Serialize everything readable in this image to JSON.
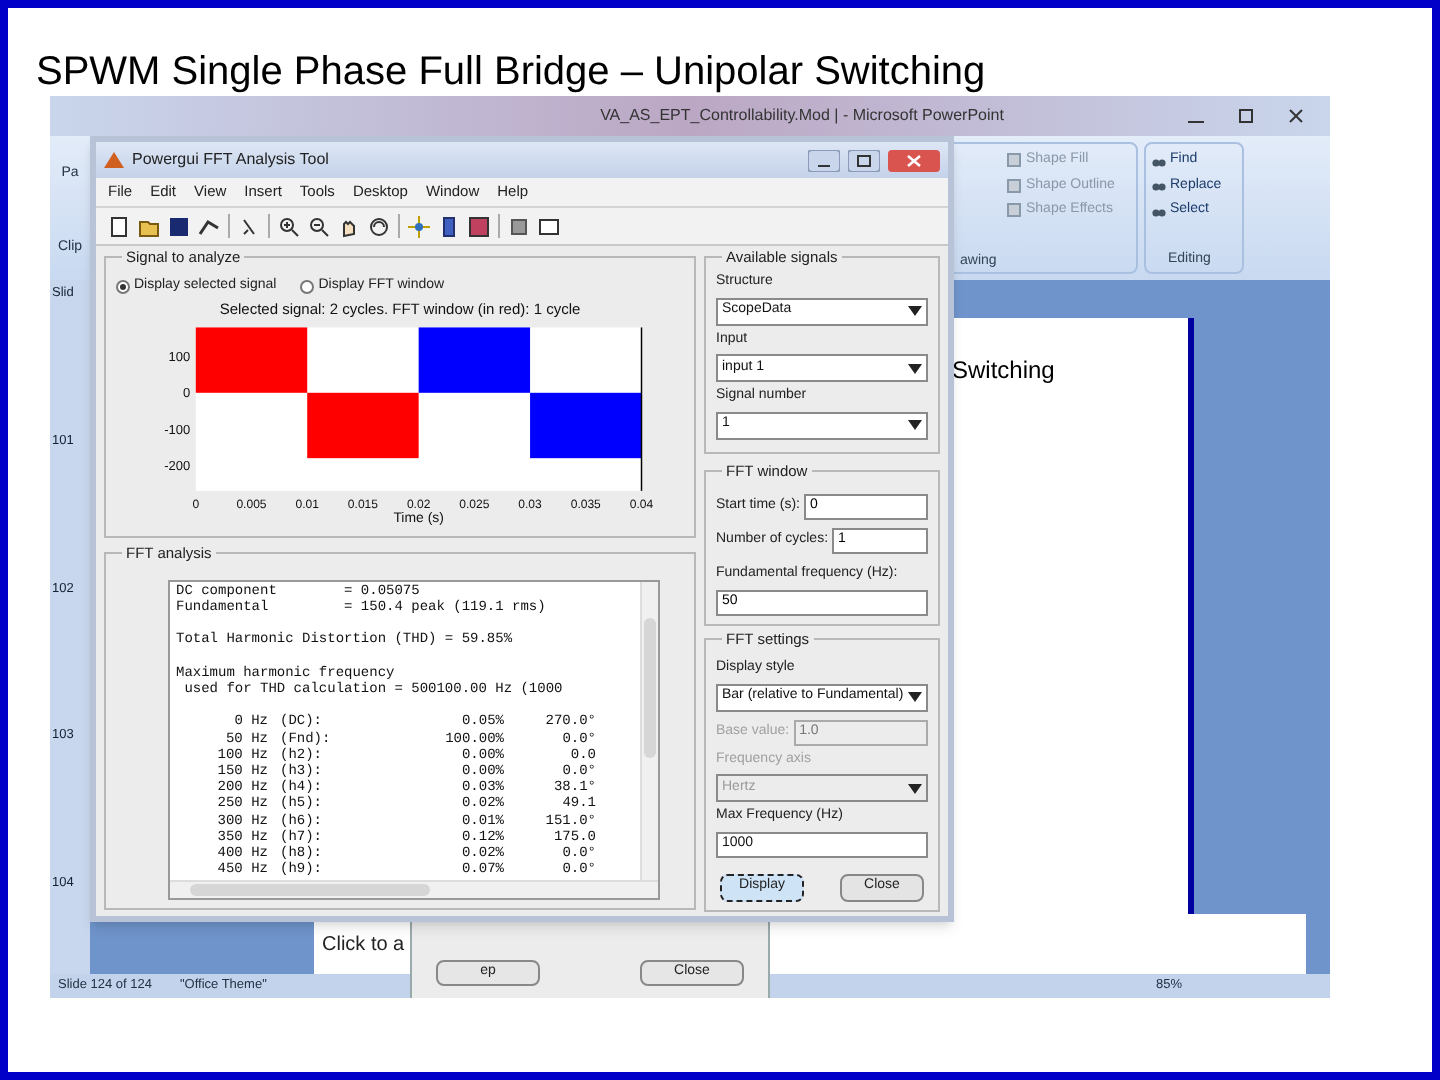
{
  "slide_title": "SPWM Single Phase Full Bridge – Unipolar Switching",
  "powerpoint": {
    "title": "VA_AS_EPT_Controllability.Mod | - Microsoft PowerPoint",
    "ribbon_left": [
      {
        "label": "Pa"
      },
      {
        "label": "Clip"
      }
    ],
    "drawing_items": [
      {
        "label": "Shape Fill"
      },
      {
        "label": "Shape Outline"
      },
      {
        "label": "Shape Effects"
      }
    ],
    "drawing_group": "awing",
    "editing_items": [
      {
        "label": "Find"
      },
      {
        "label": "Replace"
      },
      {
        "label": "Select"
      }
    ],
    "editing_group": "Editing",
    "slide_tab": "Slid",
    "thumb_numbers": [
      "101",
      "102",
      "103",
      "104"
    ],
    "slide_preview_text": "Switching",
    "notes_placeholder": "Click to a",
    "status": [
      {
        "label": "Slide 124 of 124"
      },
      {
        "label": "\"Office Theme\""
      }
    ],
    "zoom": "85%"
  },
  "back_dialog": {
    "buttons": [
      "ep",
      "Close"
    ]
  },
  "fft_window": {
    "title": "Powergui FFT Analysis Tool",
    "menu": [
      "File",
      "Edit",
      "View",
      "Insert",
      "Tools",
      "Desktop",
      "Window",
      "Help"
    ],
    "signal_group": {
      "title": "Signal to analyze",
      "radios": [
        {
          "label": "Display selected signal",
          "selected": true
        },
        {
          "label": "Display FFT window",
          "selected": false
        }
      ],
      "chart_data": {
        "type": "bar",
        "title": "Selected signal: 2 cycles. FFT window (in red): 1 cycle",
        "xlabel": "Time (s)",
        "x": [
          0.005,
          0.015,
          0.025,
          0.035
        ],
        "xlim": [
          0,
          0.04
        ],
        "ylim": [
          -270,
          180
        ],
        "series": [
          {
            "color": "#ff0000",
            "values": [
              180,
              -180,
              null,
              null
            ]
          },
          {
            "color": "#0000ff",
            "values": [
              null,
              null,
              180,
              -180
            ]
          }
        ],
        "xticks": [
          {
            "value": 0,
            "label": "0"
          },
          {
            "value": 0.005,
            "label": "0.005"
          },
          {
            "value": 0.01,
            "label": "0.01"
          },
          {
            "value": 0.015,
            "label": "0.015"
          },
          {
            "value": 0.02,
            "label": "0.02"
          },
          {
            "value": 0.025,
            "label": "0.025"
          },
          {
            "value": 0.03,
            "label": "0.03"
          },
          {
            "value": 0.035,
            "label": "0.035"
          },
          {
            "value": 0.04,
            "label": "0.04"
          }
        ],
        "yticks": [
          100,
          0,
          -100,
          -200
        ]
      }
    },
    "analysis_group": {
      "title": "FFT analysis",
      "summary": [
        [
          "DC component        = 0.05075",
          "Fundamental         = 150.4 peak (119.1 rms)"
        ],
        [
          "Total Harmonic Distortion (THD) = 59.85%"
        ],
        [
          "Maximum harmonic frequency",
          " used for THD calculation = 500100.00 Hz (1000"
        ]
      ],
      "harmonics": [
        {
          "freq": "0 Hz",
          "order": "(DC):",
          "mag": "0.05%",
          "phase": "270.0°"
        },
        {
          "freq": "50 Hz",
          "order": "(Fnd):",
          "mag": "100.00%",
          "phase": "0.0°"
        },
        {
          "freq": "100 Hz",
          "order": "(h2):",
          "mag": "0.00%",
          "phase": "0.0"
        },
        {
          "freq": "150 Hz",
          "order": "(h3):",
          "mag": "0.00%",
          "phase": "0.0°"
        },
        {
          "freq": "200 Hz",
          "order": "(h4):",
          "mag": "0.03%",
          "phase": "38.1°"
        },
        {
          "freq": "250 Hz",
          "order": "(h5):",
          "mag": "0.02%",
          "phase": "49.1"
        },
        {
          "freq": "300 Hz",
          "order": "(h6):",
          "mag": "0.01%",
          "phase": "151.0°"
        },
        {
          "freq": "350 Hz",
          "order": "(h7):",
          "mag": "0.12%",
          "phase": "175.0"
        },
        {
          "freq": "400 Hz",
          "order": "(h8):",
          "mag": "0.02%",
          "phase": "0.0°"
        },
        {
          "freq": "450 Hz",
          "order": "(h9):",
          "mag": "0.07%",
          "phase": "0.0°"
        }
      ]
    },
    "available_signals": {
      "title": "Available signals",
      "fields": [
        {
          "label": "Structure",
          "value": "ScopeData"
        },
        {
          "label": "Input",
          "value": "input 1"
        },
        {
          "label": "Signal number",
          "value": "1"
        }
      ]
    },
    "fft_window_group": {
      "title": "FFT window",
      "fields": [
        {
          "label": "Start time (s):",
          "value": "0",
          "kind": "inline"
        },
        {
          "label": "Number of cycles:",
          "value": "1",
          "kind": "inline"
        },
        {
          "label": "Fundamental frequency (Hz):",
          "value": "50",
          "kind": "text"
        }
      ]
    },
    "fft_settings": {
      "title": "FFT settings",
      "fields": [
        {
          "label": "Display style",
          "value": "Bar (relative to Fundamental)",
          "kind": "dropdown",
          "disabled": false
        },
        {
          "label": "Base value:",
          "value": "1.0",
          "kind": "inline",
          "disabled": true
        },
        {
          "label": "Frequency axis",
          "value": "Hertz",
          "kind": "dropdown",
          "disabled": true
        },
        {
          "label": "Max Frequency (Hz)",
          "value": "1000",
          "kind": "text",
          "disabled": false
        }
      ]
    },
    "buttons": [
      {
        "label": "Display",
        "focused": true
      },
      {
        "label": "Close",
        "focused": false
      }
    ]
  }
}
